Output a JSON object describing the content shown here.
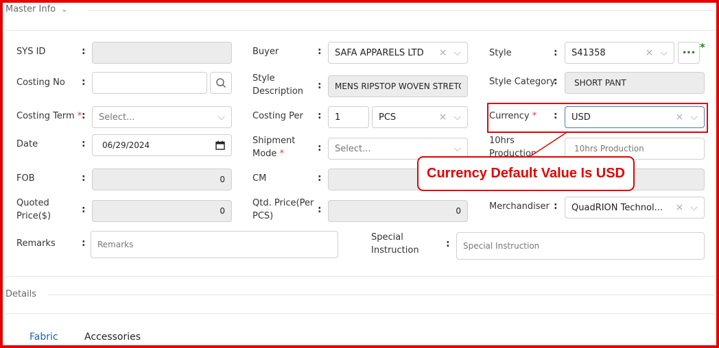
{
  "master_info": {
    "title": "Master Info"
  },
  "fields": {
    "sys_id": {
      "label": "SYS ID",
      "value": ""
    },
    "costing_no": {
      "label": "Costing No",
      "value": ""
    },
    "costing_term": {
      "label": "Costing Term",
      "required": "*",
      "placeholder": "Select..."
    },
    "date": {
      "label": "Date",
      "value": "06/29/2024"
    },
    "fob": {
      "label": "FOB",
      "value": "0"
    },
    "quoted_price": {
      "label_line1": "Quoted",
      "label_line2": "Price($)",
      "value": "0"
    },
    "remarks": {
      "label": "Remarks",
      "placeholder": "Remarks"
    },
    "buyer": {
      "label": "Buyer",
      "value": "SAFA APPARELS LTD"
    },
    "style_description": {
      "label_line1": "Style",
      "label_line2": "Description",
      "value": "MENS RIPSTOP WOVEN STRETCH"
    },
    "costing_per": {
      "label": "Costing Per",
      "qty": "1",
      "unit": "PCS"
    },
    "shipment_mode": {
      "label_line1": "Shipment",
      "label_line2": "Mode",
      "required": "*",
      "placeholder": "Select..."
    },
    "cm": {
      "label": "CM",
      "value": ""
    },
    "qtd_price": {
      "label_line1": "Qtd. Price(Per",
      "label_line2": "PCS)",
      "value": "0"
    },
    "special_instruction": {
      "label_line1": "Special",
      "label_line2": "Instruction",
      "placeholder": "Special Instruction"
    },
    "style": {
      "label": "Style",
      "value": "S41358",
      "more": "•••",
      "required": "*"
    },
    "style_category": {
      "label": "Style Category",
      "value": "SHORT PANT"
    },
    "currency": {
      "label": "Currency",
      "required": "*",
      "value": "USD"
    },
    "production_10hrs": {
      "label_line1": "10hrs",
      "label_line2": "Production",
      "placeholder": "10hrs Production"
    },
    "merchandiser": {
      "label": "Merchandiser",
      "value": "QuadRION Technol..."
    }
  },
  "annotation": {
    "text": "Currency Default Value Is USD",
    "color": "#e60000"
  },
  "details": {
    "title": "Details",
    "tabs": [
      "Fabric",
      "Accessories"
    ]
  },
  "icons": {
    "clear": "×",
    "chevron": "⌵",
    "search": "search-icon",
    "calendar": "calendar-icon"
  },
  "colors": {
    "accent": "#1a5fb4",
    "required": "#e53935",
    "annotation": "#e60000",
    "readonly": "#ececec",
    "more_dots": "#2e7d32"
  }
}
